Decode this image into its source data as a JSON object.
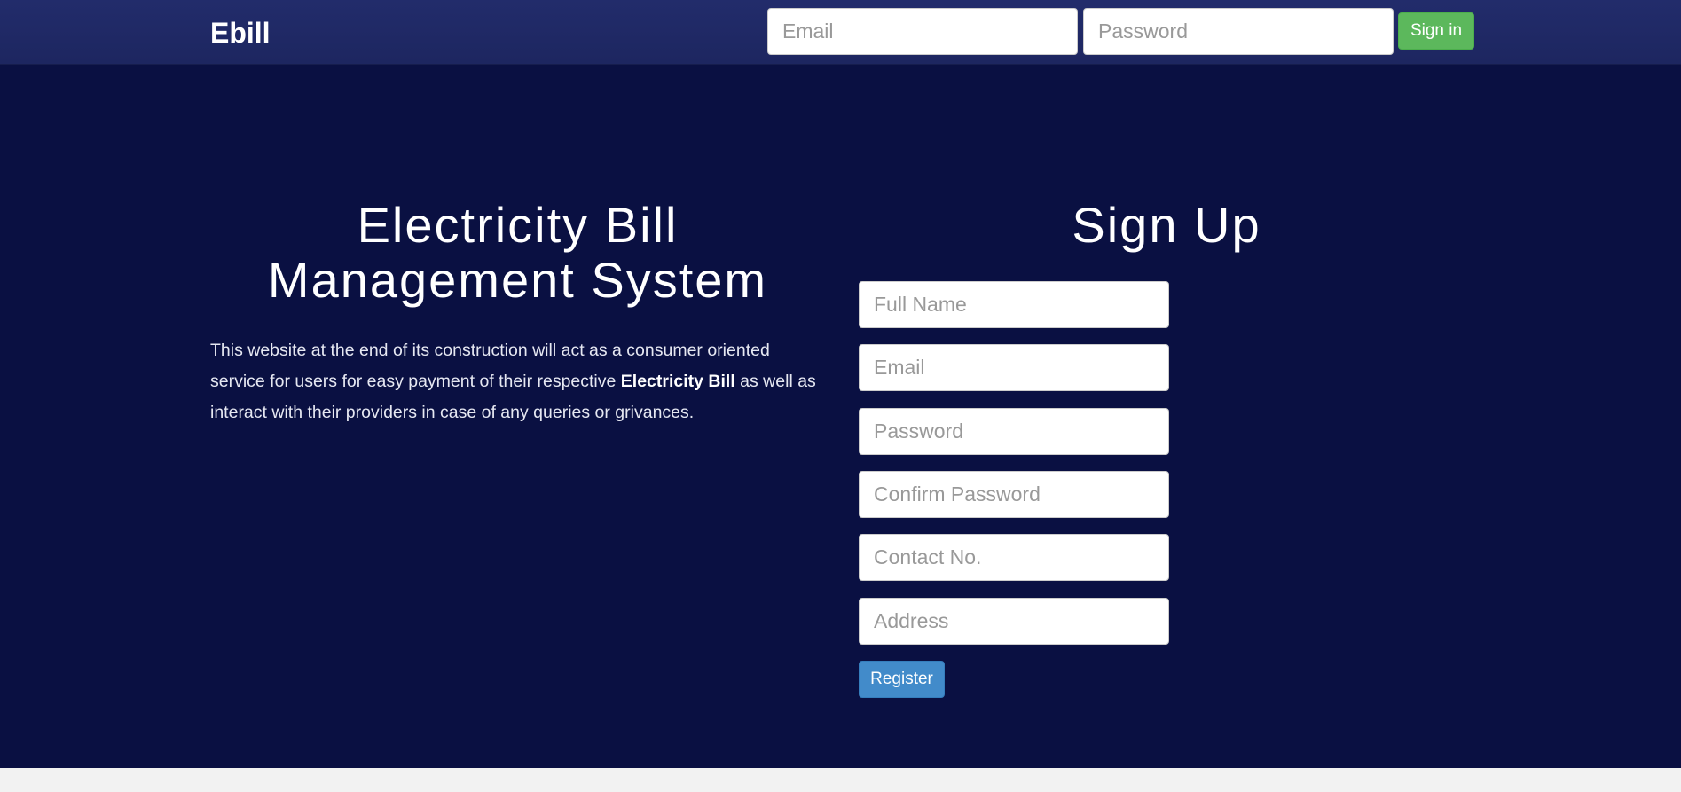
{
  "navbar": {
    "brand": "Ebill",
    "email_placeholder": "Email",
    "password_placeholder": "Password",
    "signin_label": "Sign in",
    "signin_color": "#5cb85c",
    "background_color": "#222c6b"
  },
  "hero": {
    "title_line1": "Electricity Bill",
    "title_line2": "Management System",
    "description_before": "This website at the end of its construction will act as a consumer oriented service for users for easy payment of their respective ",
    "description_bold": "Electricity Bill",
    "description_after": " as well as interact with their providers in case of any queries or grivances.",
    "background_color": "#0a1042"
  },
  "signup": {
    "title": "Sign Up",
    "fields": {
      "full_name_placeholder": "Full Name",
      "email_placeholder": "Email",
      "password_placeholder": "Password",
      "confirm_password_placeholder": "Confirm Password",
      "contact_placeholder": "Contact No.",
      "address_placeholder": "Address"
    },
    "register_label": "Register",
    "register_color": "#428bca"
  }
}
